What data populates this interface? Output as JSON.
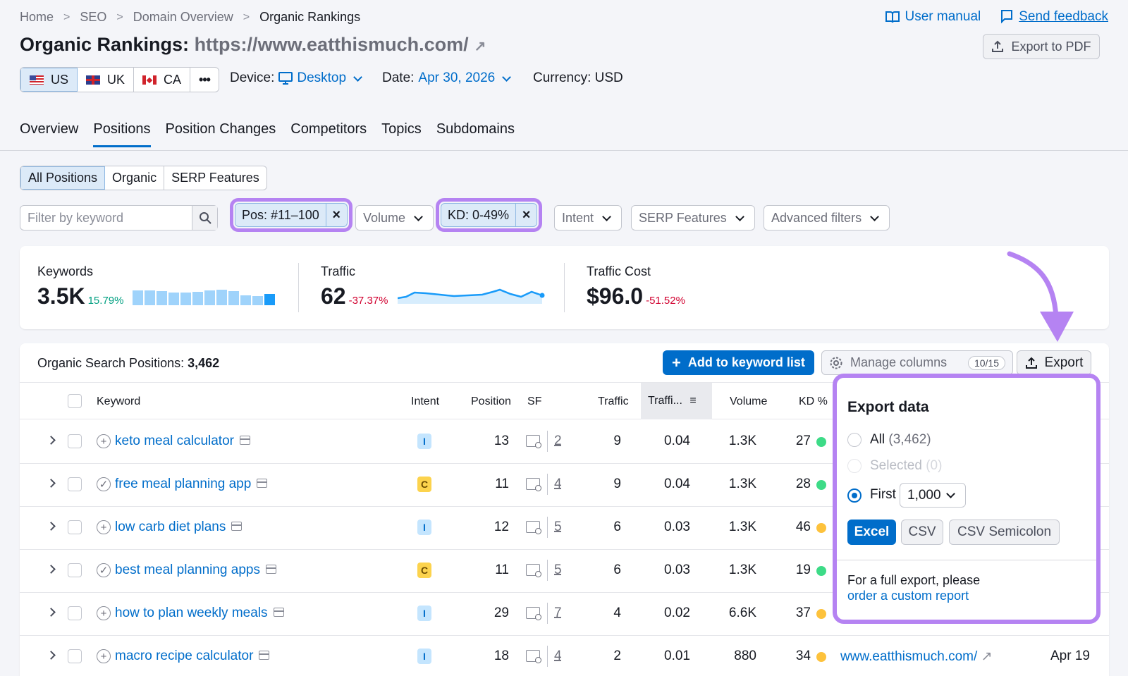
{
  "breadcrumb": [
    "Home",
    "SEO",
    "Domain Overview",
    "Organic Rankings"
  ],
  "top_links": {
    "manual": "User manual",
    "feedback": "Send feedback"
  },
  "title": {
    "label": "Organic Rankings:",
    "url": "https://www.eatthismuch.com/"
  },
  "export_pdf": "Export to PDF",
  "databases": [
    {
      "code": "US",
      "flag": "us-flag-icon"
    },
    {
      "code": "UK",
      "flag": "uk-flag-icon"
    },
    {
      "code": "CA",
      "flag": "ca-flag-icon"
    }
  ],
  "more": "•••",
  "device": {
    "label": "Device:",
    "value": "Desktop"
  },
  "date": {
    "label": "Date:",
    "value": "Apr 30, 2026"
  },
  "currency": "Currency: USD",
  "tabs": [
    "Overview",
    "Positions",
    "Position Changes",
    "Competitors",
    "Topics",
    "Subdomains"
  ],
  "subtabs": [
    "All Positions",
    "Organic",
    "SERP Features"
  ],
  "filters": {
    "search_placeholder": "Filter by keyword",
    "pos_chip": "Pos: #11–100",
    "kd_chip": "KD: 0-49%",
    "volume": "Volume",
    "intent": "Intent",
    "serp": "SERP Features",
    "advanced": "Advanced filters"
  },
  "summary": {
    "keywords": {
      "label": "Keywords",
      "value": "3.5K",
      "change": "15.79%",
      "bar_levels": [
        0.8,
        0.8,
        0.75,
        0.7,
        0.7,
        0.72,
        0.8,
        0.85,
        0.75,
        0.55,
        0.5,
        0.6
      ]
    },
    "traffic": {
      "label": "Traffic",
      "value": "62",
      "change": "-37.37%"
    },
    "cost": {
      "label": "Traffic Cost",
      "value": "$96.0",
      "change": "-51.52%"
    }
  },
  "table": {
    "title": "Organic Search Positions:",
    "count": "3,462",
    "add_btn": "Add to keyword list",
    "manage_btn": "Manage columns",
    "manage_count": "10/15",
    "export_btn": "Export",
    "headers": {
      "keyword": "Keyword",
      "intent": "Intent",
      "position": "Position",
      "sf": "SF",
      "traffic": "Traffic",
      "traffic_pct": "Traffi...",
      "volume": "Volume",
      "kd": "KD %"
    },
    "rows": [
      {
        "keyword": "keto meal calculator",
        "intent": "I",
        "position": "13",
        "sf": "2",
        "traffic": "9",
        "traffic_pct": "0.04",
        "volume": "1.3K",
        "kd": "27",
        "kd_color": "#3ddb87"
      },
      {
        "keyword": "free meal planning app",
        "intent": "C",
        "position": "11",
        "sf": "4",
        "traffic": "9",
        "traffic_pct": "0.04",
        "volume": "1.3K",
        "kd": "28",
        "kd_color": "#3ddb87"
      },
      {
        "keyword": "low carb diet plans",
        "intent": "I",
        "position": "12",
        "sf": "5",
        "traffic": "6",
        "traffic_pct": "0.03",
        "volume": "1.3K",
        "kd": "46",
        "kd_color": "#fdc23c"
      },
      {
        "keyword": "best meal planning apps",
        "intent": "C",
        "position": "11",
        "sf": "5",
        "traffic": "6",
        "traffic_pct": "0.03",
        "volume": "1.3K",
        "kd": "19",
        "kd_color": "#3ddb87"
      },
      {
        "keyword": "how to plan weekly meals",
        "intent": "I",
        "position": "29",
        "sf": "7",
        "traffic": "4",
        "traffic_pct": "0.02",
        "volume": "6.6K",
        "kd": "37",
        "kd_color": "#fdc23c"
      },
      {
        "keyword": "macro recipe calculator",
        "intent": "I",
        "position": "18",
        "sf": "4",
        "traffic": "2",
        "traffic_pct": "0.01",
        "volume": "880",
        "kd": "34",
        "kd_color": "#fdc23c",
        "url": "www.eatthismuch.com/",
        "updated": "Apr 19"
      }
    ]
  },
  "export_popup": {
    "title": "Export data",
    "all_label": "All",
    "all_count": "(3,462)",
    "selected_label": "Selected",
    "selected_count": "(0)",
    "first_label": "First",
    "first_value": "1,000",
    "formats": [
      "Excel",
      "CSV",
      "CSV Semicolon"
    ],
    "footer_text": "For a full export, please",
    "footer_link": "order a custom report"
  },
  "colors": {
    "accent": "#006dca",
    "highlight": "#b583f2",
    "up": "#009f81",
    "down": "#d1002f"
  }
}
